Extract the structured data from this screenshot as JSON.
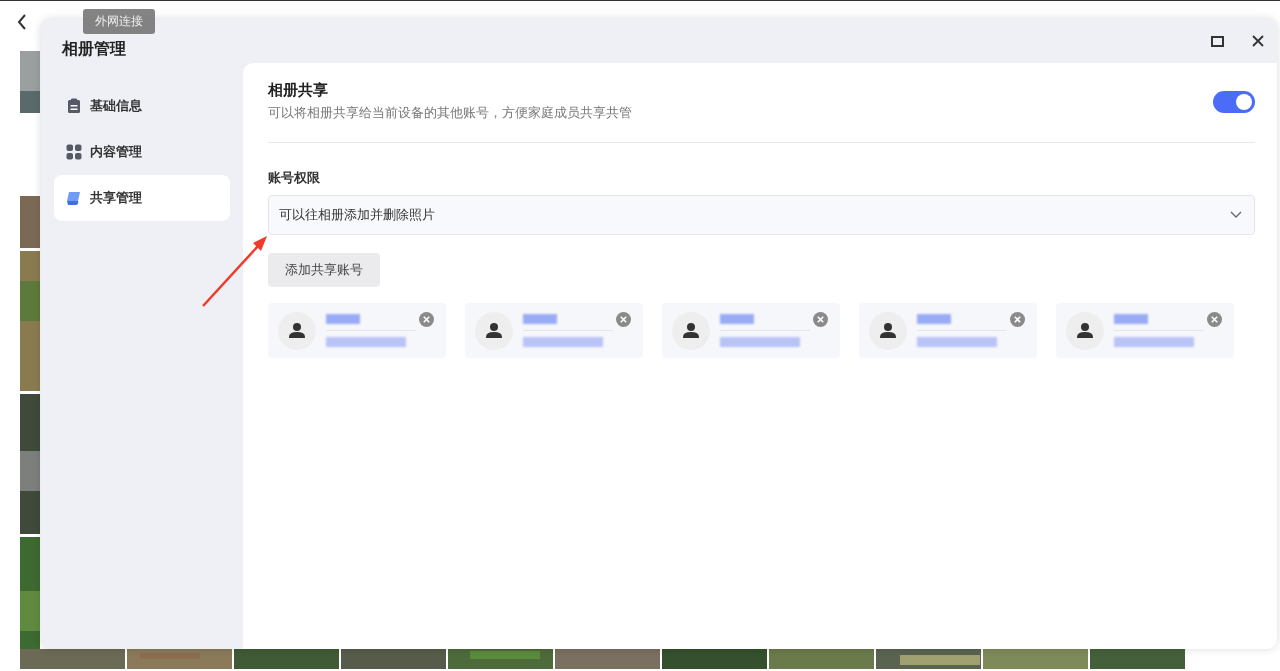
{
  "tooltip": "外网连接",
  "dialog": {
    "title": "相册管理"
  },
  "sidebar": {
    "items": [
      {
        "label": "基础信息",
        "kind": "clipboard",
        "selected": false
      },
      {
        "label": "内容管理",
        "kind": "grid",
        "selected": false
      },
      {
        "label": "共享管理",
        "kind": "share",
        "selected": true
      }
    ]
  },
  "sharing": {
    "title": "相册共享",
    "description": "可以将相册共享给当前设备的其他账号，方便家庭成员共享共管",
    "on": true
  },
  "permission": {
    "label": "账号权限",
    "value": "可以往相册添加并删除照片"
  },
  "add_button": "添加共享账号",
  "accounts": [
    {
      "kind": "redacted"
    },
    {
      "kind": "redacted"
    },
    {
      "kind": "redacted"
    },
    {
      "kind": "redacted"
    },
    {
      "kind": "redacted"
    }
  ]
}
